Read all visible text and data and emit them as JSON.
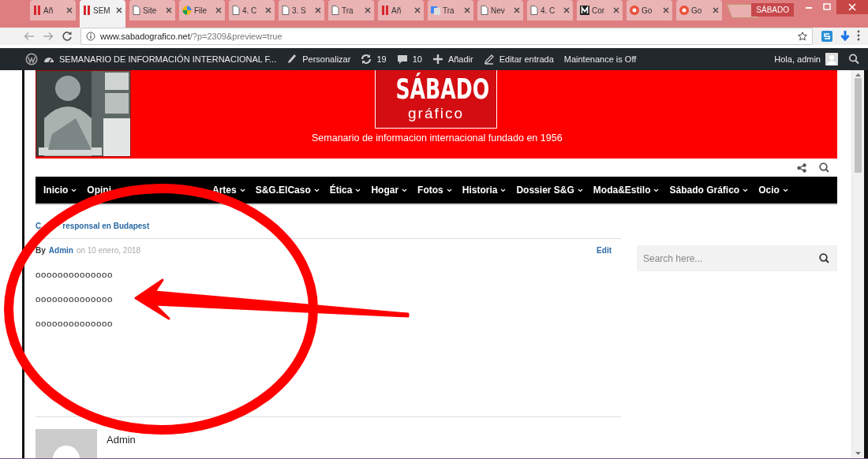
{
  "browser": {
    "tabs": [
      {
        "label": "Añ",
        "kind": "bars",
        "selected": false
      },
      {
        "label": "SEM",
        "kind": "bars",
        "selected": true
      },
      {
        "label": "Site",
        "kind": "page",
        "selected": false
      },
      {
        "label": "File",
        "kind": "color",
        "selected": false
      },
      {
        "label": "4. C",
        "kind": "page",
        "selected": false
      },
      {
        "label": "3. S",
        "kind": "page",
        "selected": false
      },
      {
        "label": "Tra",
        "kind": "page",
        "selected": false
      },
      {
        "label": "Añ",
        "kind": "bars",
        "selected": false
      },
      {
        "label": "Tra",
        "kind": "translate",
        "selected": false
      },
      {
        "label": "Nev",
        "kind": "page",
        "selected": false
      },
      {
        "label": "4. C",
        "kind": "page",
        "selected": false
      },
      {
        "label": "Cor",
        "kind": "m",
        "selected": false
      },
      {
        "label": "Go",
        "kind": "circle",
        "selected": false
      },
      {
        "label": "Go",
        "kind": "circle",
        "selected": false
      }
    ],
    "window_title": "SÁBADO",
    "url_host": "www.sabadografico.net",
    "url_path": "/?p=2309&preview=true"
  },
  "admin_bar": {
    "site_name": "SEMANARIO DE INFORMACIÓN INTERNACIONAL F...",
    "items": [
      {
        "kind": "customize",
        "label": "Personalizar"
      },
      {
        "kind": "updates",
        "label": "19"
      },
      {
        "kind": "comments",
        "label": "10"
      },
      {
        "kind": "new",
        "label": "Añadir"
      },
      {
        "kind": "edit",
        "label": "Editar entrada"
      },
      {
        "kind": "text",
        "label": "Maintenance is Off"
      }
    ],
    "greeting": "Hola, admin"
  },
  "header": {
    "logo_word": "SÁBADO",
    "logo_sub": "gráfico",
    "tagline": "Semanario de informacion internacional fundado en 1956"
  },
  "nav": [
    {
      "label": "Inicio",
      "chevron": true
    },
    {
      "label": "Opini",
      "chevron": false
    },
    {
      "label": "Artes",
      "chevron": true
    },
    {
      "label": "S&G.ElCaso",
      "chevron": true
    },
    {
      "label": "Ética",
      "chevron": true
    },
    {
      "label": "Hogar",
      "chevron": true
    },
    {
      "label": "Fotos",
      "chevron": true
    },
    {
      "label": "Historia",
      "chevron": true
    },
    {
      "label": "Dossier S&G",
      "chevron": true
    },
    {
      "label": "Moda&Estilo",
      "chevron": true
    },
    {
      "label": "Sábado Gráfico",
      "chevron": true
    },
    {
      "label": "Ocio",
      "chevron": true
    }
  ],
  "post": {
    "category_start": "C",
    "category_end": "responsal en Budapest",
    "by": "By",
    "author": "Admin",
    "date": "on 10 enero, 2018",
    "edit": "Edit",
    "paragraphs": [
      "oooooooooooooo",
      "oooooooooooooo",
      "oooooooooooooo"
    ],
    "author_box": {
      "name": "Admin"
    }
  },
  "sidebar": {
    "search": {
      "placeholder": "Search here..."
    }
  }
}
